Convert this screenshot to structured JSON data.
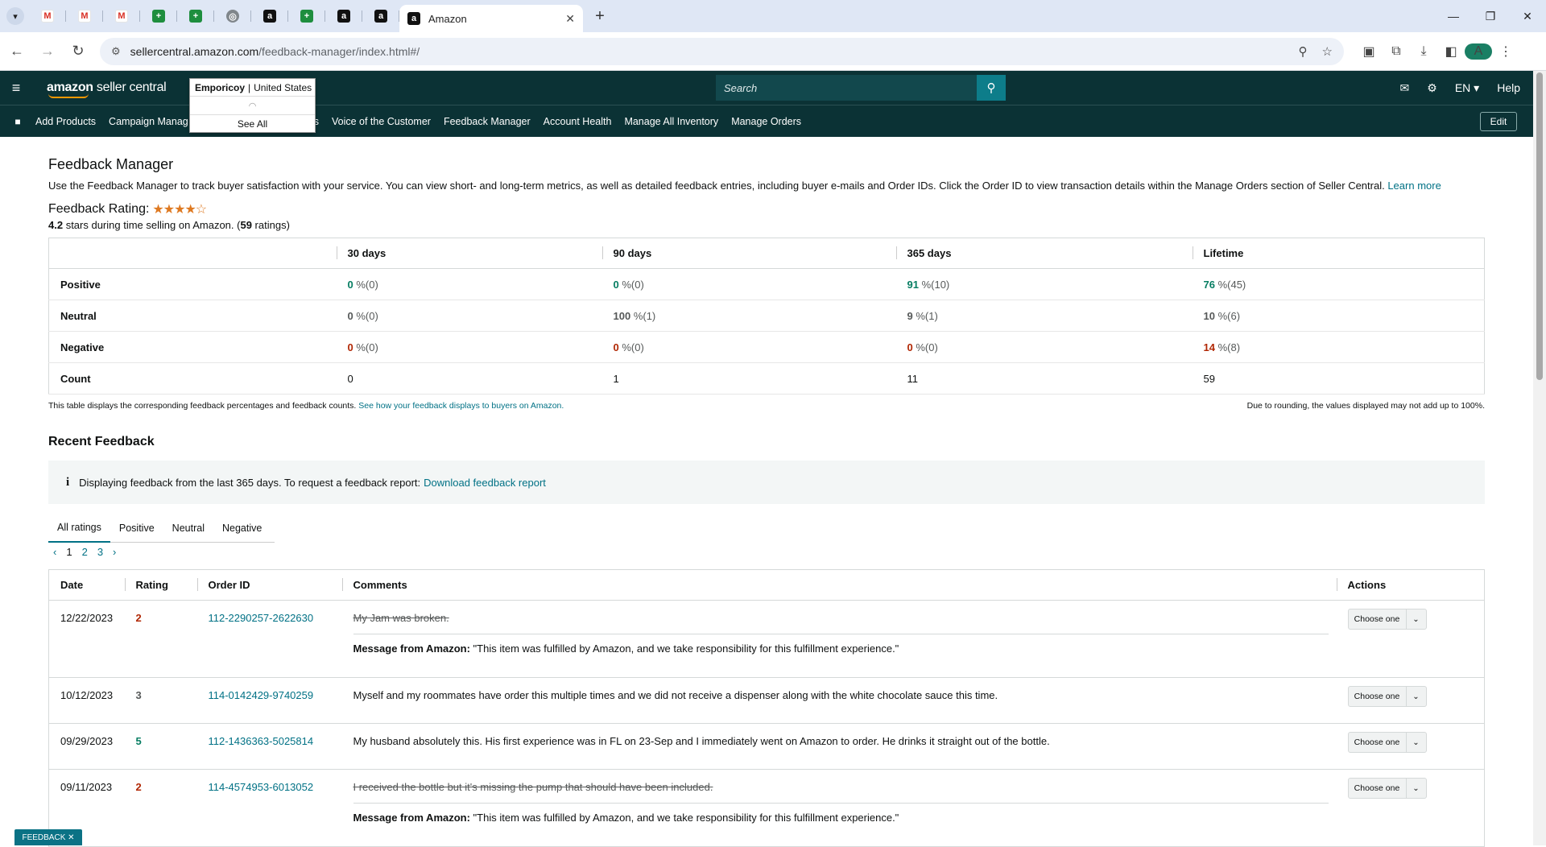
{
  "browser": {
    "tab_menu_icon": "chevron-down",
    "pinned_tabs": [
      {
        "icon": "gmail-icon",
        "glyph": "M",
        "cls": "gm"
      },
      {
        "icon": "gmail-icon",
        "glyph": "M",
        "cls": "gm"
      },
      {
        "icon": "gmail-icon",
        "glyph": "M",
        "cls": "gm"
      },
      {
        "icon": "sheets-icon",
        "glyph": "+",
        "cls": "sh"
      },
      {
        "icon": "sheets-icon",
        "glyph": "+",
        "cls": "sh"
      },
      {
        "icon": "globe-icon",
        "glyph": "◎",
        "cls": "gl"
      },
      {
        "icon": "amazon-icon",
        "glyph": "a",
        "cls": "am"
      },
      {
        "icon": "sheets-icon",
        "glyph": "+",
        "cls": "sh"
      },
      {
        "icon": "amazon-icon",
        "glyph": "a",
        "cls": "am"
      },
      {
        "icon": "amazon-icon",
        "glyph": "a",
        "cls": "am"
      }
    ],
    "active_tab_title": "Amazon",
    "url_host": "sellercentral.amazon.com",
    "url_path": "/feedback-manager/index.html#/",
    "profile_initial": "A"
  },
  "header": {
    "logo_main": "amazon",
    "logo_sub": " seller central",
    "account_name": "Emporicoy",
    "account_sep": "|",
    "account_region": "United States",
    "see_all": "See All",
    "search_placeholder": "Search",
    "language": "EN ▾",
    "help": "Help"
  },
  "nav": {
    "items": [
      "Add Products",
      "Campaign Manag",
      "s",
      "Voice of the Customer",
      "Feedback Manager",
      "Account Health",
      "Manage All Inventory",
      "Manage Orders"
    ],
    "edit": "Edit"
  },
  "page": {
    "title": "Feedback Manager",
    "intro": "Use the Feedback Manager to track buyer satisfaction with your service. You can view short- and long-term metrics, as well as detailed feedback entries, including buyer e-mails and Order IDs. Click the Order ID to view transaction details within the Manage Orders section of Seller Central. ",
    "learn_more": "Learn more",
    "rating_label": "Feedback Rating:",
    "rating_stars": 4,
    "rating_value": "4.2",
    "rating_text_a": " stars during time selling on Amazon. (",
    "rating_count": "59",
    "rating_text_b": " ratings)"
  },
  "metrics": {
    "columns": [
      "30 days",
      "90 days",
      "365 days",
      "Lifetime"
    ],
    "rows": [
      {
        "label": "Positive",
        "cells": [
          [
            "0",
            " %(0)"
          ],
          [
            "0",
            " %(0)"
          ],
          [
            "91",
            " %(10)"
          ],
          [
            "76",
            " %(45)"
          ]
        ],
        "cls": "pos"
      },
      {
        "label": "Neutral",
        "cells": [
          [
            "0",
            " %(0)"
          ],
          [
            "100",
            " %(1)"
          ],
          [
            "9",
            " %(1)"
          ],
          [
            "10",
            " %(6)"
          ]
        ],
        "cls": "neu"
      },
      {
        "label": "Negative",
        "cells": [
          [
            "0",
            " %(0)"
          ],
          [
            "0",
            " %(0)"
          ],
          [
            "0",
            " %(0)"
          ],
          [
            "14",
            " %(8)"
          ]
        ],
        "cls": "neg"
      },
      {
        "label": "Count",
        "cells": [
          [
            "0",
            ""
          ],
          [
            "1",
            ""
          ],
          [
            "11",
            ""
          ],
          [
            "59",
            ""
          ]
        ],
        "cls": "cnt"
      }
    ],
    "note_left": "This table displays the corresponding feedback percentages and feedback counts. ",
    "note_link": "See how your feedback displays to buyers on Amazon.",
    "note_right": "Due to rounding, the values displayed may not add up to 100%."
  },
  "recent": {
    "title": "Recent Feedback",
    "info": "Displaying feedback from the last 365 days. To request a feedback report: ",
    "info_link": "Download feedback report",
    "tabs": [
      "All ratings",
      "Positive",
      "Neutral",
      "Negative"
    ],
    "pages": [
      "1",
      "2",
      "3"
    ],
    "columns": [
      "Date",
      "Rating",
      "Order ID",
      "Comments",
      "Actions"
    ],
    "action_label": "Choose one",
    "msg_label": "Message from Amazon:",
    "rows": [
      {
        "date": "12/22/2023",
        "rating": "2",
        "rcls": "neg",
        "order": "112-2290257-2622630",
        "comment": "My Jam was broken.",
        "struck": true,
        "msg": " \"This item was fulfilled by Amazon, and we take responsibility for this fulfillment experience.\""
      },
      {
        "date": "10/12/2023",
        "rating": "3",
        "rcls": "neu",
        "order": "114-0142429-9740259",
        "comment": "Myself and my roommates have order this multiple times and we did not receive a dispenser along with the white chocolate sauce this time.",
        "struck": false,
        "msg": ""
      },
      {
        "date": "09/29/2023",
        "rating": "5",
        "rcls": "pos",
        "order": "112-1436363-5025814",
        "comment": "My husband absolutely this. His first experience was in FL on 23-Sep and I immediately went on Amazon to order. He drinks it straight out of the bottle.",
        "struck": false,
        "msg": ""
      },
      {
        "date": "09/11/2023",
        "rating": "2",
        "rcls": "neg",
        "order": "114-4574953-6013052",
        "comment": "I received the bottle but it's missing the pump that should have been included.",
        "struck": true,
        "msg": " \"This item was fulfilled by Amazon, and we take responsibility for this fulfillment experience.\""
      }
    ]
  },
  "feedback_tab": "FEEDBACK ✕",
  "colors": {
    "header_bg": "#0b3235",
    "link": "#007185",
    "positive": "#067d62",
    "negative": "#b12704",
    "star": "#de7921"
  }
}
